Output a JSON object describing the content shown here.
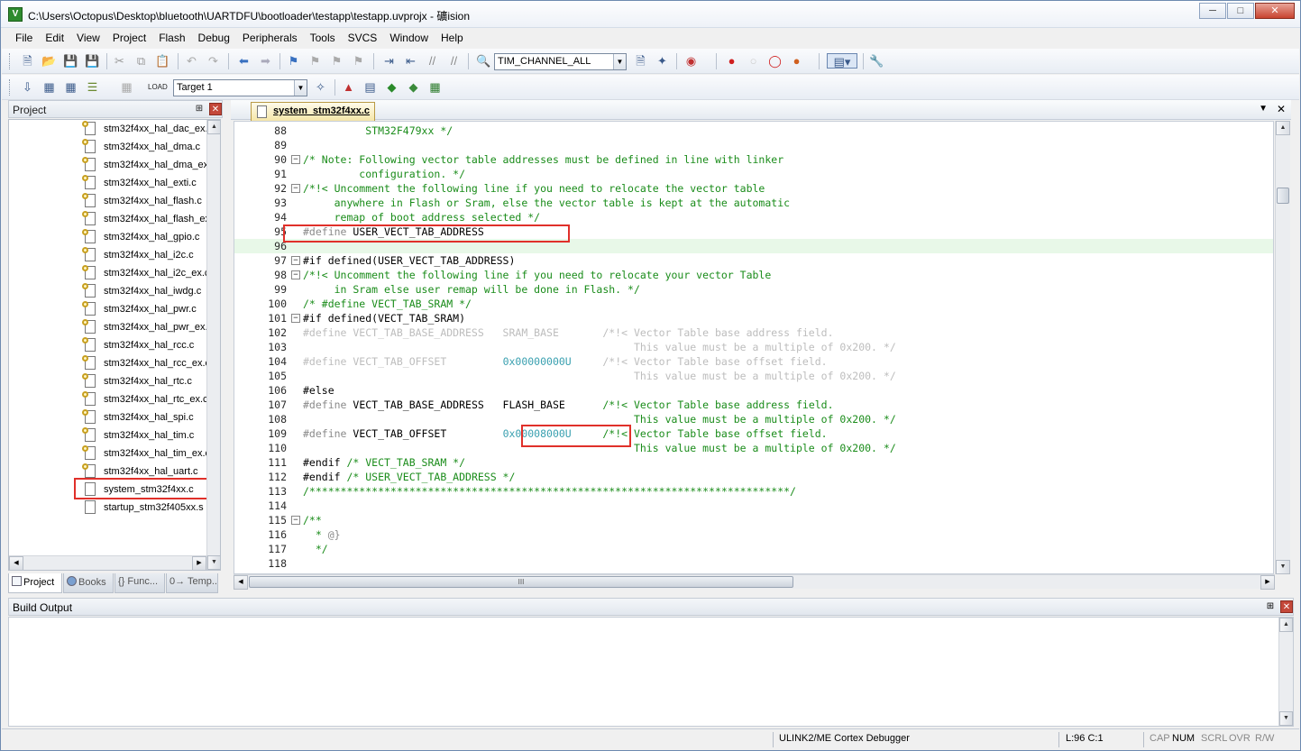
{
  "window": {
    "title": "C:\\Users\\Octopus\\Desktop\\bluetooth\\UARTDFU\\bootloader\\testapp\\testapp.uvprojx - 礦ision",
    "icon_name": "keil-uvision-icon",
    "minimize_label": "─",
    "maximize_label": "□",
    "close_label": "✕"
  },
  "menu": [
    "File",
    "Edit",
    "View",
    "Project",
    "Flash",
    "Debug",
    "Peripherals",
    "Tools",
    "SVCS",
    "Window",
    "Help"
  ],
  "toolbar": {
    "find_combo_value": "TIM_CHANNEL_ALL",
    "target_combo_value": "Target 1"
  },
  "project_panel": {
    "title": "Project",
    "files": [
      "stm32f4xx_hal_dac_ex.c",
      "stm32f4xx_hal_dma.c",
      "stm32f4xx_hal_dma_ex.c",
      "stm32f4xx_hal_exti.c",
      "stm32f4xx_hal_flash.c",
      "stm32f4xx_hal_flash_ex.c",
      "stm32f4xx_hal_gpio.c",
      "stm32f4xx_hal_i2c.c",
      "stm32f4xx_hal_i2c_ex.c",
      "stm32f4xx_hal_iwdg.c",
      "stm32f4xx_hal_pwr.c",
      "stm32f4xx_hal_pwr_ex.c",
      "stm32f4xx_hal_rcc.c",
      "stm32f4xx_hal_rcc_ex.c",
      "stm32f4xx_hal_rtc.c",
      "stm32f4xx_hal_rtc_ex.c",
      "stm32f4xx_hal_spi.c",
      "stm32f4xx_hal_tim.c",
      "stm32f4xx_hal_tim_ex.c",
      "stm32f4xx_hal_uart.c",
      "system_stm32f4xx.c",
      "startup_stm32f405xx.s"
    ],
    "selected_file": "system_stm32f4xx.c",
    "tabs": [
      "Project",
      "Books",
      "{} Func...",
      "0→ Temp..."
    ]
  },
  "editor": {
    "active_tab": "system_stm32f4xx.c",
    "scroll_indicator": "III",
    "highlighted_line": 96,
    "lines": [
      {
        "n": "88",
        "fold": "",
        "segs": [
          {
            "c": "cm",
            "t": "          STM32F479xx */"
          }
        ]
      },
      {
        "n": "89",
        "fold": "",
        "segs": []
      },
      {
        "n": "90",
        "fold": "−",
        "segs": [
          {
            "c": "cm",
            "t": "/* Note: Following vector table addresses must be defined in line with linker"
          }
        ]
      },
      {
        "n": "91",
        "fold": "",
        "segs": [
          {
            "c": "cm",
            "t": "         configuration. */"
          }
        ]
      },
      {
        "n": "92",
        "fold": "−",
        "segs": [
          {
            "c": "cm",
            "t": "/*!< Uncomment the following line if you need to relocate the vector table"
          }
        ]
      },
      {
        "n": "93",
        "fold": "",
        "segs": [
          {
            "c": "cm",
            "t": "     anywhere in Flash or Sram, else the vector table is kept at the automatic"
          }
        ]
      },
      {
        "n": "94",
        "fold": "",
        "segs": [
          {
            "c": "cm",
            "t": "     remap of boot address selected */"
          }
        ]
      },
      {
        "n": "95",
        "fold": "",
        "segs": [
          {
            "c": "pp",
            "t": "#define"
          },
          {
            "c": "",
            "t": " USER_VECT_TAB_ADDRESS"
          }
        ]
      },
      {
        "n": "96",
        "fold": "",
        "segs": []
      },
      {
        "n": "97",
        "fold": "−",
        "segs": [
          {
            "c": "",
            "t": "#if defined(USER_VECT_TAB_ADDRESS)"
          }
        ]
      },
      {
        "n": "98",
        "fold": "−",
        "segs": [
          {
            "c": "cm",
            "t": "/*!< Uncomment the following line if you need to relocate your vector Table"
          }
        ]
      },
      {
        "n": "99",
        "fold": "",
        "segs": [
          {
            "c": "cm",
            "t": "     in Sram else user remap will be done in Flash. */"
          }
        ]
      },
      {
        "n": "100",
        "fold": "",
        "segs": [
          {
            "c": "cm",
            "t": "/* #define VECT_TAB_SRAM */"
          }
        ]
      },
      {
        "n": "101",
        "fold": "−",
        "segs": [
          {
            "c": "",
            "t": "#if defined(VECT_TAB_SRAM)"
          }
        ]
      },
      {
        "n": "102",
        "fold": "",
        "segs": [
          {
            "c": "gr",
            "t": "#define VECT_TAB_BASE_ADDRESS   SRAM_BASE       /*!< Vector Table base address field."
          }
        ]
      },
      {
        "n": "103",
        "fold": "",
        "segs": [
          {
            "c": "gr",
            "t": "                                                     This value must be a multiple of 0x200. */"
          }
        ]
      },
      {
        "n": "104",
        "fold": "",
        "segs": [
          {
            "c": "gr",
            "t": "#define VECT_TAB_OFFSET         "
          },
          {
            "c": "nm",
            "t": "0x00000000U"
          },
          {
            "c": "gr",
            "t": "     /*!< Vector Table base offset field."
          }
        ]
      },
      {
        "n": "105",
        "fold": "",
        "segs": [
          {
            "c": "gr",
            "t": "                                                     This value must be a multiple of 0x200. */"
          }
        ]
      },
      {
        "n": "106",
        "fold": "",
        "segs": [
          {
            "c": "",
            "t": "#else"
          }
        ]
      },
      {
        "n": "107",
        "fold": "",
        "segs": [
          {
            "c": "pp",
            "t": "#define"
          },
          {
            "c": "",
            "t": " VECT_TAB_BASE_ADDRESS   FLASH_BASE      "
          },
          {
            "c": "cm",
            "t": "/*!< Vector Table base address field."
          }
        ]
      },
      {
        "n": "108",
        "fold": "",
        "segs": [
          {
            "c": "cm",
            "t": "                                                     This value must be a multiple of 0x200. */"
          }
        ]
      },
      {
        "n": "109",
        "fold": "",
        "segs": [
          {
            "c": "pp",
            "t": "#define"
          },
          {
            "c": "",
            "t": " VECT_TAB_OFFSET         "
          },
          {
            "c": "nm",
            "t": "0x00008000U"
          },
          {
            "c": "",
            "t": "     "
          },
          {
            "c": "cm",
            "t": "/*!< Vector Table base offset field."
          }
        ]
      },
      {
        "n": "110",
        "fold": "",
        "segs": [
          {
            "c": "cm",
            "t": "                                                     This value must be a multiple of 0x200. */"
          }
        ]
      },
      {
        "n": "111",
        "fold": "",
        "segs": [
          {
            "c": "",
            "t": "#endif "
          },
          {
            "c": "cm",
            "t": "/* VECT_TAB_SRAM */"
          }
        ]
      },
      {
        "n": "112",
        "fold": "",
        "segs": [
          {
            "c": "",
            "t": "#endif "
          },
          {
            "c": "cm",
            "t": "/* USER_VECT_TAB_ADDRESS */"
          }
        ]
      },
      {
        "n": "113",
        "fold": "",
        "segs": [
          {
            "c": "cm",
            "t": "/*****************************************************************************/"
          }
        ]
      },
      {
        "n": "114",
        "fold": "",
        "segs": []
      },
      {
        "n": "115",
        "fold": "−",
        "segs": [
          {
            "c": "cm",
            "t": "/**"
          }
        ]
      },
      {
        "n": "116",
        "fold": "",
        "segs": [
          {
            "c": "cm",
            "t": "  * "
          },
          {
            "c": "pp",
            "t": "@}"
          }
        ]
      },
      {
        "n": "117",
        "fold": "",
        "segs": [
          {
            "c": "cm",
            "t": "  */"
          }
        ]
      },
      {
        "n": "118",
        "fold": "",
        "segs": []
      }
    ]
  },
  "build_output": {
    "title": "Build Output"
  },
  "statusbar": {
    "debugger": "ULINK2/ME Cortex Debugger",
    "position": "L:96 C:1",
    "indicators": [
      "CAP",
      "NUM",
      "SCRL",
      "OVR",
      "R/W"
    ]
  },
  "colors": {
    "comment": "#1a8c1a",
    "preprocessor": "#8a8a8a",
    "number": "#3aa0b0",
    "inactive": "#bdbdbd",
    "highlight_box": "#e0302a",
    "current_line": "#e8f8e8"
  }
}
